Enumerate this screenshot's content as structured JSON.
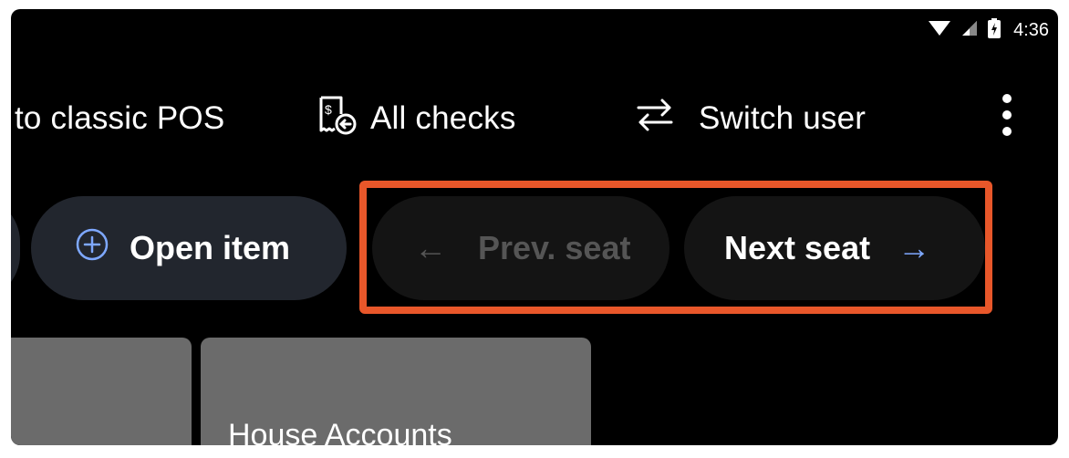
{
  "status": {
    "time": "4:36",
    "icons": [
      "wifi-icon",
      "signal-icon",
      "battery-charging-icon"
    ]
  },
  "action_bar": {
    "classic_pos_label": "to classic POS",
    "all_checks_label": "All checks",
    "switch_user_label": "Switch user",
    "more_icon": "more-vertical-icon"
  },
  "pills": {
    "open_item_label": "Open item",
    "prev_seat_label": "Prev. seat",
    "next_seat_label": "Next seat",
    "prev_arrow": "←",
    "next_arrow": "→"
  },
  "tiles": {
    "house_accounts_label": "House Accounts"
  },
  "colors": {
    "highlight": "#e8572a",
    "accent": "#7ea8ff",
    "pill_bg": "#22262e",
    "tile_bg": "#6b6b6b"
  }
}
